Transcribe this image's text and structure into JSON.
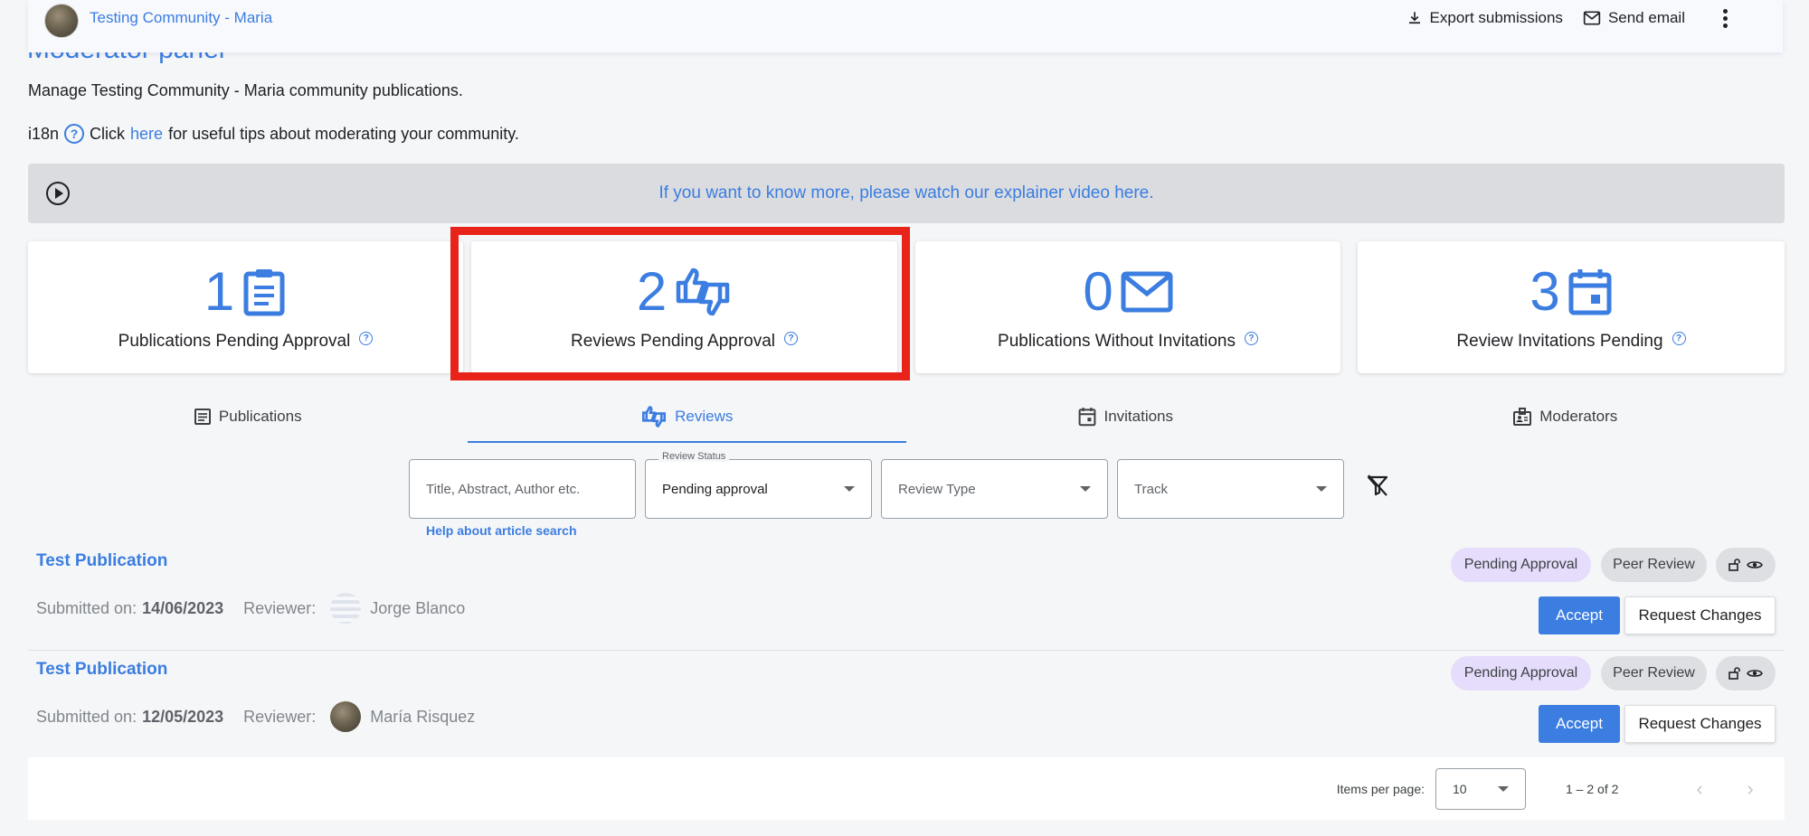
{
  "topbar": {
    "community_title": "Testing Community - Maria",
    "export_label": "Export submissions",
    "email_label": "Send email"
  },
  "page": {
    "title": "Moderator panel",
    "manage_text": "Manage Testing Community - Maria community publications.",
    "tips_prefix": "i18n",
    "tips_click": "Click",
    "tips_link": "here",
    "tips_suffix": "for useful tips about moderating your community.",
    "video_text": "If you want to know more, please watch our explainer video here."
  },
  "stats": [
    {
      "count": "1",
      "label": "Publications Pending Approval",
      "icon": "clipboard-icon"
    },
    {
      "count": "2",
      "label": "Reviews Pending Approval",
      "icon": "thumbs-up-down-icon"
    },
    {
      "count": "0",
      "label": "Publications Without Invitations",
      "icon": "envelope-icon"
    },
    {
      "count": "3",
      "label": "Review Invitations Pending",
      "icon": "calendar-icon"
    }
  ],
  "tabs": [
    {
      "label": "Publications",
      "icon": "document-icon"
    },
    {
      "label": "Reviews",
      "icon": "thumbs-up-down-icon",
      "active": true
    },
    {
      "label": "Invitations",
      "icon": "calendar-icon"
    },
    {
      "label": "Moderators",
      "icon": "badge-icon"
    }
  ],
  "filters": {
    "search_placeholder": "Title, Abstract, Author etc.",
    "status_legend": "Review Status",
    "status_value": "Pending approval",
    "type_placeholder": "Review Type",
    "track_placeholder": "Track",
    "help_link": "Help about article search"
  },
  "reviews": [
    {
      "title": "Test Publication",
      "submitted_label": "Submitted on:",
      "date": "14/06/2023",
      "reviewer_label": "Reviewer:",
      "reviewer": "Jorge Blanco",
      "status": "Pending Approval",
      "type": "Peer Review"
    },
    {
      "title": "Test Publication",
      "submitted_label": "Submitted on:",
      "date": "12/05/2023",
      "reviewer_label": "Reviewer:",
      "reviewer": "María Risquez",
      "status": "Pending Approval",
      "type": "Peer Review"
    }
  ],
  "actions": {
    "accept": "Accept",
    "request_changes": "Request Changes"
  },
  "paginator": {
    "label": "Items per page:",
    "page_size": "10",
    "range": "1 – 2 of 2"
  },
  "colors": {
    "accent": "#3b7de0",
    "highlight": "#e8231a",
    "pending_chip": "#e6dcfb"
  }
}
